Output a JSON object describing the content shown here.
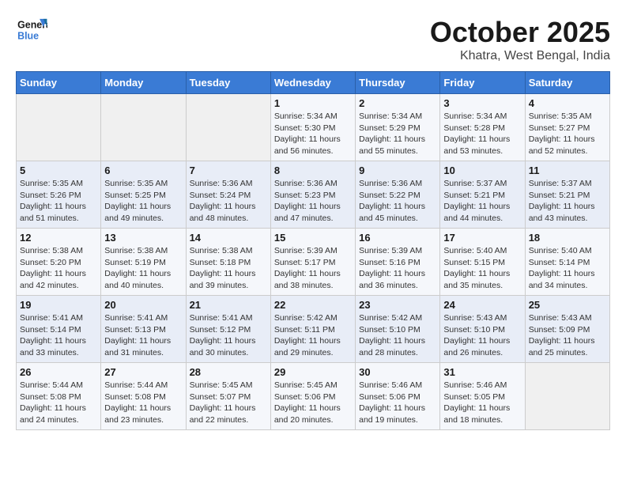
{
  "logo": {
    "line1": "General",
    "line2": "Blue"
  },
  "title": "October 2025",
  "subtitle": "Khatra, West Bengal, India",
  "weekdays": [
    "Sunday",
    "Monday",
    "Tuesday",
    "Wednesday",
    "Thursday",
    "Friday",
    "Saturday"
  ],
  "weeks": [
    [
      {
        "day": "",
        "sunrise": "",
        "sunset": "",
        "daylight": ""
      },
      {
        "day": "",
        "sunrise": "",
        "sunset": "",
        "daylight": ""
      },
      {
        "day": "",
        "sunrise": "",
        "sunset": "",
        "daylight": ""
      },
      {
        "day": "1",
        "sunrise": "Sunrise: 5:34 AM",
        "sunset": "Sunset: 5:30 PM",
        "daylight": "Daylight: 11 hours and 56 minutes."
      },
      {
        "day": "2",
        "sunrise": "Sunrise: 5:34 AM",
        "sunset": "Sunset: 5:29 PM",
        "daylight": "Daylight: 11 hours and 55 minutes."
      },
      {
        "day": "3",
        "sunrise": "Sunrise: 5:34 AM",
        "sunset": "Sunset: 5:28 PM",
        "daylight": "Daylight: 11 hours and 53 minutes."
      },
      {
        "day": "4",
        "sunrise": "Sunrise: 5:35 AM",
        "sunset": "Sunset: 5:27 PM",
        "daylight": "Daylight: 11 hours and 52 minutes."
      }
    ],
    [
      {
        "day": "5",
        "sunrise": "Sunrise: 5:35 AM",
        "sunset": "Sunset: 5:26 PM",
        "daylight": "Daylight: 11 hours and 51 minutes."
      },
      {
        "day": "6",
        "sunrise": "Sunrise: 5:35 AM",
        "sunset": "Sunset: 5:25 PM",
        "daylight": "Daylight: 11 hours and 49 minutes."
      },
      {
        "day": "7",
        "sunrise": "Sunrise: 5:36 AM",
        "sunset": "Sunset: 5:24 PM",
        "daylight": "Daylight: 11 hours and 48 minutes."
      },
      {
        "day": "8",
        "sunrise": "Sunrise: 5:36 AM",
        "sunset": "Sunset: 5:23 PM",
        "daylight": "Daylight: 11 hours and 47 minutes."
      },
      {
        "day": "9",
        "sunrise": "Sunrise: 5:36 AM",
        "sunset": "Sunset: 5:22 PM",
        "daylight": "Daylight: 11 hours and 45 minutes."
      },
      {
        "day": "10",
        "sunrise": "Sunrise: 5:37 AM",
        "sunset": "Sunset: 5:21 PM",
        "daylight": "Daylight: 11 hours and 44 minutes."
      },
      {
        "day": "11",
        "sunrise": "Sunrise: 5:37 AM",
        "sunset": "Sunset: 5:21 PM",
        "daylight": "Daylight: 11 hours and 43 minutes."
      }
    ],
    [
      {
        "day": "12",
        "sunrise": "Sunrise: 5:38 AM",
        "sunset": "Sunset: 5:20 PM",
        "daylight": "Daylight: 11 hours and 42 minutes."
      },
      {
        "day": "13",
        "sunrise": "Sunrise: 5:38 AM",
        "sunset": "Sunset: 5:19 PM",
        "daylight": "Daylight: 11 hours and 40 minutes."
      },
      {
        "day": "14",
        "sunrise": "Sunrise: 5:38 AM",
        "sunset": "Sunset: 5:18 PM",
        "daylight": "Daylight: 11 hours and 39 minutes."
      },
      {
        "day": "15",
        "sunrise": "Sunrise: 5:39 AM",
        "sunset": "Sunset: 5:17 PM",
        "daylight": "Daylight: 11 hours and 38 minutes."
      },
      {
        "day": "16",
        "sunrise": "Sunrise: 5:39 AM",
        "sunset": "Sunset: 5:16 PM",
        "daylight": "Daylight: 11 hours and 36 minutes."
      },
      {
        "day": "17",
        "sunrise": "Sunrise: 5:40 AM",
        "sunset": "Sunset: 5:15 PM",
        "daylight": "Daylight: 11 hours and 35 minutes."
      },
      {
        "day": "18",
        "sunrise": "Sunrise: 5:40 AM",
        "sunset": "Sunset: 5:14 PM",
        "daylight": "Daylight: 11 hours and 34 minutes."
      }
    ],
    [
      {
        "day": "19",
        "sunrise": "Sunrise: 5:41 AM",
        "sunset": "Sunset: 5:14 PM",
        "daylight": "Daylight: 11 hours and 33 minutes."
      },
      {
        "day": "20",
        "sunrise": "Sunrise: 5:41 AM",
        "sunset": "Sunset: 5:13 PM",
        "daylight": "Daylight: 11 hours and 31 minutes."
      },
      {
        "day": "21",
        "sunrise": "Sunrise: 5:41 AM",
        "sunset": "Sunset: 5:12 PM",
        "daylight": "Daylight: 11 hours and 30 minutes."
      },
      {
        "day": "22",
        "sunrise": "Sunrise: 5:42 AM",
        "sunset": "Sunset: 5:11 PM",
        "daylight": "Daylight: 11 hours and 29 minutes."
      },
      {
        "day": "23",
        "sunrise": "Sunrise: 5:42 AM",
        "sunset": "Sunset: 5:10 PM",
        "daylight": "Daylight: 11 hours and 28 minutes."
      },
      {
        "day": "24",
        "sunrise": "Sunrise: 5:43 AM",
        "sunset": "Sunset: 5:10 PM",
        "daylight": "Daylight: 11 hours and 26 minutes."
      },
      {
        "day": "25",
        "sunrise": "Sunrise: 5:43 AM",
        "sunset": "Sunset: 5:09 PM",
        "daylight": "Daylight: 11 hours and 25 minutes."
      }
    ],
    [
      {
        "day": "26",
        "sunrise": "Sunrise: 5:44 AM",
        "sunset": "Sunset: 5:08 PM",
        "daylight": "Daylight: 11 hours and 24 minutes."
      },
      {
        "day": "27",
        "sunrise": "Sunrise: 5:44 AM",
        "sunset": "Sunset: 5:08 PM",
        "daylight": "Daylight: 11 hours and 23 minutes."
      },
      {
        "day": "28",
        "sunrise": "Sunrise: 5:45 AM",
        "sunset": "Sunset: 5:07 PM",
        "daylight": "Daylight: 11 hours and 22 minutes."
      },
      {
        "day": "29",
        "sunrise": "Sunrise: 5:45 AM",
        "sunset": "Sunset: 5:06 PM",
        "daylight": "Daylight: 11 hours and 20 minutes."
      },
      {
        "day": "30",
        "sunrise": "Sunrise: 5:46 AM",
        "sunset": "Sunset: 5:06 PM",
        "daylight": "Daylight: 11 hours and 19 minutes."
      },
      {
        "day": "31",
        "sunrise": "Sunrise: 5:46 AM",
        "sunset": "Sunset: 5:05 PM",
        "daylight": "Daylight: 11 hours and 18 minutes."
      },
      {
        "day": "",
        "sunrise": "",
        "sunset": "",
        "daylight": ""
      }
    ]
  ]
}
